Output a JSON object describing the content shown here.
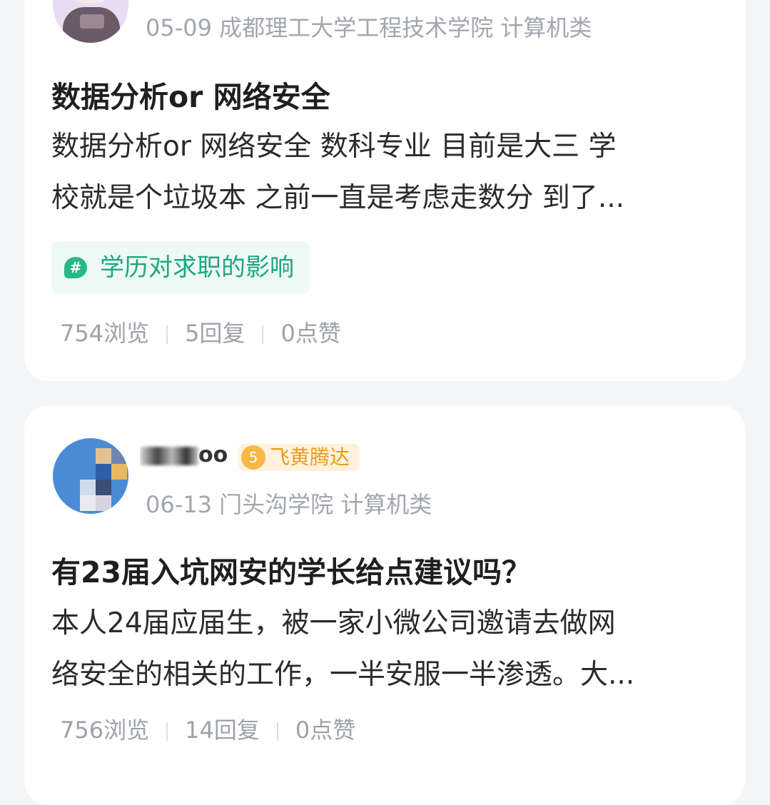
{
  "posts": [
    {
      "date": "05-09",
      "school": "成都理工大学工程技术学院",
      "category": "计算机类",
      "title": "数据分析or 网络安全",
      "body_lines": [
        "数据分析or 网络安全 数科专业 目前是大三 学",
        "校就是个垃圾本 之前一直是考虑走数分 到了..."
      ],
      "tag": "学历对求职的影响",
      "views": "754浏览",
      "replies": "5回复",
      "likes": "0点赞"
    },
    {
      "username": "oo",
      "level": "5",
      "level_title": "飞黄腾达",
      "date": "06-13",
      "school": "门头沟学院",
      "category": "计算机类",
      "title": "有23届入坑网安的学长给点建议吗？",
      "body_lines": [
        "本人24届应届生，被一家小微公司邀请去做网",
        "络安全的相关的工作，一半安服一半渗透。大..."
      ],
      "views": "756浏览",
      "replies": "14回复",
      "likes": "0点赞"
    }
  ],
  "colors": {
    "tag_green": "#1ea77e",
    "badge_orange": "#ec9a1d",
    "meta_gray": "#a2a6ad"
  },
  "icons": [
    "avatar",
    "hashtag-icon",
    "level-badge-icon"
  ]
}
